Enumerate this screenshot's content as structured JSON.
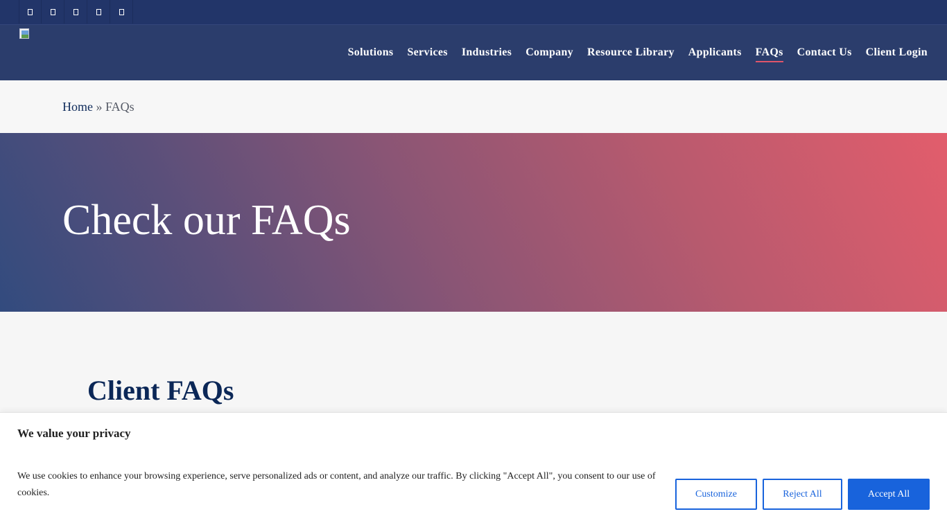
{
  "topbar": {
    "social_icons": [
      "facebook-icon",
      "twitter-icon",
      "linkedin-icon",
      "instagram-icon",
      "youtube-icon"
    ]
  },
  "header": {
    "nav": [
      {
        "label": "Solutions",
        "active": false
      },
      {
        "label": "Services",
        "active": false
      },
      {
        "label": "Industries",
        "active": false
      },
      {
        "label": "Company",
        "active": false
      },
      {
        "label": "Resource Library",
        "active": false
      },
      {
        "label": "Applicants",
        "active": false
      },
      {
        "label": "FAQs",
        "active": true
      },
      {
        "label": "Contact Us",
        "active": false
      },
      {
        "label": "Client Login",
        "active": false
      }
    ]
  },
  "breadcrumb": {
    "home": "Home",
    "separator": "»",
    "current": "FAQs"
  },
  "hero": {
    "title": "Check our FAQs"
  },
  "content": {
    "section_title": "Client FAQs"
  },
  "cookie_banner": {
    "title": "We value your privacy",
    "text": "We use cookies to enhance your browsing experience, serve personalized ads or content, and analyze our traffic. By clicking \"Accept All\", you consent to our use of cookies.",
    "customize_label": "Customize",
    "reject_label": "Reject All",
    "accept_label": "Accept All"
  },
  "colors": {
    "topbar": "#223569",
    "header": "#2b3d6c",
    "nav_active_underline": "#e0556a",
    "heading": "#0b2757",
    "button_blue": "#1863dc"
  }
}
